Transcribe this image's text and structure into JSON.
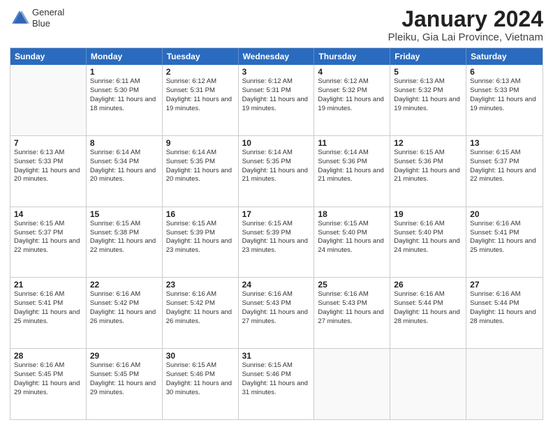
{
  "logo": {
    "line1": "General",
    "line2": "Blue"
  },
  "title": "January 2024",
  "subtitle": "Pleiku, Gia Lai Province, Vietnam",
  "header_days": [
    "Sunday",
    "Monday",
    "Tuesday",
    "Wednesday",
    "Thursday",
    "Friday",
    "Saturday"
  ],
  "weeks": [
    [
      {
        "day": "",
        "sunrise": "",
        "sunset": "",
        "daylight": ""
      },
      {
        "day": "1",
        "sunrise": "Sunrise: 6:11 AM",
        "sunset": "Sunset: 5:30 PM",
        "daylight": "Daylight: 11 hours and 18 minutes."
      },
      {
        "day": "2",
        "sunrise": "Sunrise: 6:12 AM",
        "sunset": "Sunset: 5:31 PM",
        "daylight": "Daylight: 11 hours and 19 minutes."
      },
      {
        "day": "3",
        "sunrise": "Sunrise: 6:12 AM",
        "sunset": "Sunset: 5:31 PM",
        "daylight": "Daylight: 11 hours and 19 minutes."
      },
      {
        "day": "4",
        "sunrise": "Sunrise: 6:12 AM",
        "sunset": "Sunset: 5:32 PM",
        "daylight": "Daylight: 11 hours and 19 minutes."
      },
      {
        "day": "5",
        "sunrise": "Sunrise: 6:13 AM",
        "sunset": "Sunset: 5:32 PM",
        "daylight": "Daylight: 11 hours and 19 minutes."
      },
      {
        "day": "6",
        "sunrise": "Sunrise: 6:13 AM",
        "sunset": "Sunset: 5:33 PM",
        "daylight": "Daylight: 11 hours and 19 minutes."
      }
    ],
    [
      {
        "day": "7",
        "sunrise": "Sunrise: 6:13 AM",
        "sunset": "Sunset: 5:33 PM",
        "daylight": "Daylight: 11 hours and 20 minutes."
      },
      {
        "day": "8",
        "sunrise": "Sunrise: 6:14 AM",
        "sunset": "Sunset: 5:34 PM",
        "daylight": "Daylight: 11 hours and 20 minutes."
      },
      {
        "day": "9",
        "sunrise": "Sunrise: 6:14 AM",
        "sunset": "Sunset: 5:35 PM",
        "daylight": "Daylight: 11 hours and 20 minutes."
      },
      {
        "day": "10",
        "sunrise": "Sunrise: 6:14 AM",
        "sunset": "Sunset: 5:35 PM",
        "daylight": "Daylight: 11 hours and 21 minutes."
      },
      {
        "day": "11",
        "sunrise": "Sunrise: 6:14 AM",
        "sunset": "Sunset: 5:36 PM",
        "daylight": "Daylight: 11 hours and 21 minutes."
      },
      {
        "day": "12",
        "sunrise": "Sunrise: 6:15 AM",
        "sunset": "Sunset: 5:36 PM",
        "daylight": "Daylight: 11 hours and 21 minutes."
      },
      {
        "day": "13",
        "sunrise": "Sunrise: 6:15 AM",
        "sunset": "Sunset: 5:37 PM",
        "daylight": "Daylight: 11 hours and 22 minutes."
      }
    ],
    [
      {
        "day": "14",
        "sunrise": "Sunrise: 6:15 AM",
        "sunset": "Sunset: 5:37 PM",
        "daylight": "Daylight: 11 hours and 22 minutes."
      },
      {
        "day": "15",
        "sunrise": "Sunrise: 6:15 AM",
        "sunset": "Sunset: 5:38 PM",
        "daylight": "Daylight: 11 hours and 22 minutes."
      },
      {
        "day": "16",
        "sunrise": "Sunrise: 6:15 AM",
        "sunset": "Sunset: 5:39 PM",
        "daylight": "Daylight: 11 hours and 23 minutes."
      },
      {
        "day": "17",
        "sunrise": "Sunrise: 6:15 AM",
        "sunset": "Sunset: 5:39 PM",
        "daylight": "Daylight: 11 hours and 23 minutes."
      },
      {
        "day": "18",
        "sunrise": "Sunrise: 6:15 AM",
        "sunset": "Sunset: 5:40 PM",
        "daylight": "Daylight: 11 hours and 24 minutes."
      },
      {
        "day": "19",
        "sunrise": "Sunrise: 6:16 AM",
        "sunset": "Sunset: 5:40 PM",
        "daylight": "Daylight: 11 hours and 24 minutes."
      },
      {
        "day": "20",
        "sunrise": "Sunrise: 6:16 AM",
        "sunset": "Sunset: 5:41 PM",
        "daylight": "Daylight: 11 hours and 25 minutes."
      }
    ],
    [
      {
        "day": "21",
        "sunrise": "Sunrise: 6:16 AM",
        "sunset": "Sunset: 5:41 PM",
        "daylight": "Daylight: 11 hours and 25 minutes."
      },
      {
        "day": "22",
        "sunrise": "Sunrise: 6:16 AM",
        "sunset": "Sunset: 5:42 PM",
        "daylight": "Daylight: 11 hours and 26 minutes."
      },
      {
        "day": "23",
        "sunrise": "Sunrise: 6:16 AM",
        "sunset": "Sunset: 5:42 PM",
        "daylight": "Daylight: 11 hours and 26 minutes."
      },
      {
        "day": "24",
        "sunrise": "Sunrise: 6:16 AM",
        "sunset": "Sunset: 5:43 PM",
        "daylight": "Daylight: 11 hours and 27 minutes."
      },
      {
        "day": "25",
        "sunrise": "Sunrise: 6:16 AM",
        "sunset": "Sunset: 5:43 PM",
        "daylight": "Daylight: 11 hours and 27 minutes."
      },
      {
        "day": "26",
        "sunrise": "Sunrise: 6:16 AM",
        "sunset": "Sunset: 5:44 PM",
        "daylight": "Daylight: 11 hours and 28 minutes."
      },
      {
        "day": "27",
        "sunrise": "Sunrise: 6:16 AM",
        "sunset": "Sunset: 5:44 PM",
        "daylight": "Daylight: 11 hours and 28 minutes."
      }
    ],
    [
      {
        "day": "28",
        "sunrise": "Sunrise: 6:16 AM",
        "sunset": "Sunset: 5:45 PM",
        "daylight": "Daylight: 11 hours and 29 minutes."
      },
      {
        "day": "29",
        "sunrise": "Sunrise: 6:16 AM",
        "sunset": "Sunset: 5:45 PM",
        "daylight": "Daylight: 11 hours and 29 minutes."
      },
      {
        "day": "30",
        "sunrise": "Sunrise: 6:15 AM",
        "sunset": "Sunset: 5:46 PM",
        "daylight": "Daylight: 11 hours and 30 minutes."
      },
      {
        "day": "31",
        "sunrise": "Sunrise: 6:15 AM",
        "sunset": "Sunset: 5:46 PM",
        "daylight": "Daylight: 11 hours and 31 minutes."
      },
      {
        "day": "",
        "sunrise": "",
        "sunset": "",
        "daylight": ""
      },
      {
        "day": "",
        "sunrise": "",
        "sunset": "",
        "daylight": ""
      },
      {
        "day": "",
        "sunrise": "",
        "sunset": "",
        "daylight": ""
      }
    ]
  ]
}
